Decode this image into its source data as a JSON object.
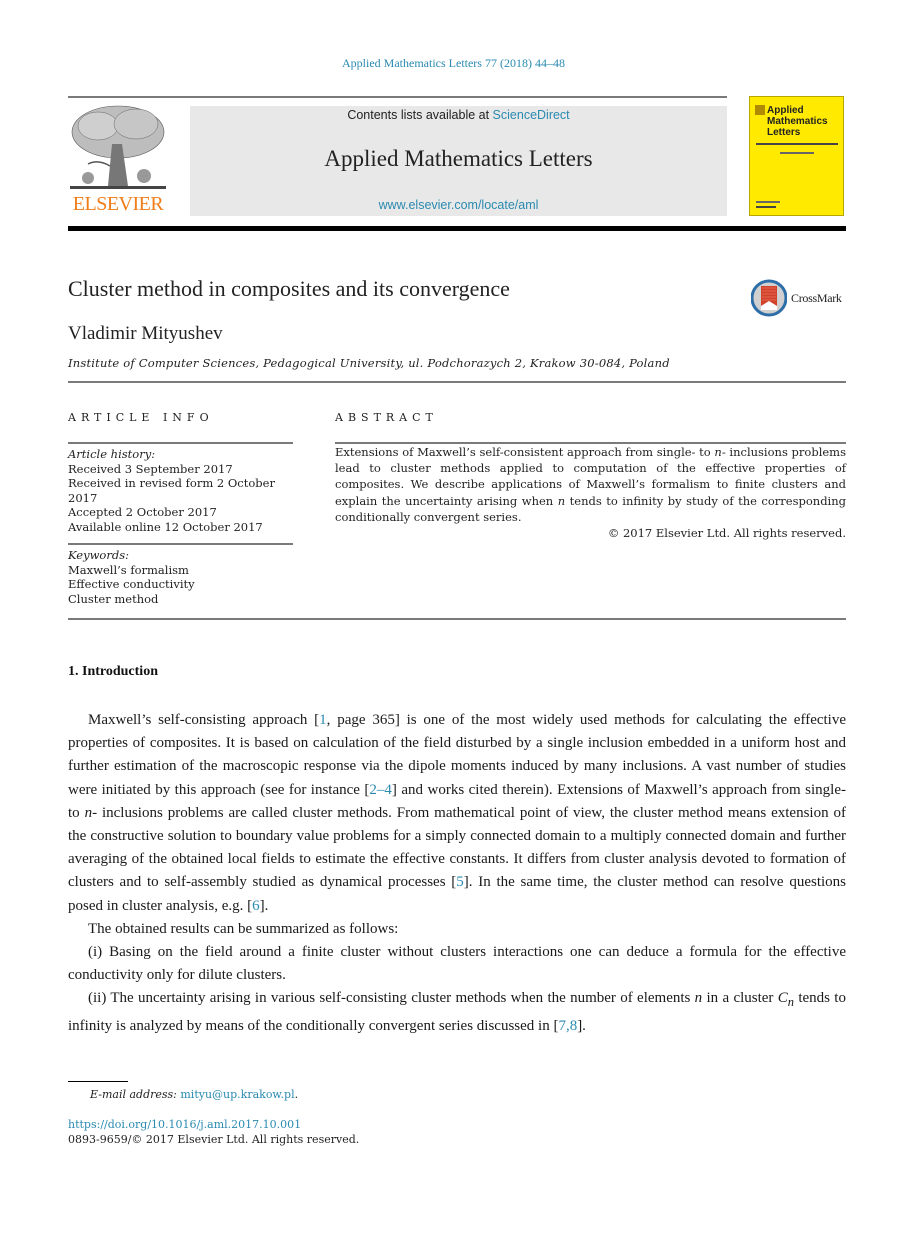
{
  "journal_reference": "Applied Mathematics Letters 77 (2018) 44–48",
  "header": {
    "publisher_logo_text": "ELSEVIER",
    "contents_prefix": "Contents lists available at ",
    "contents_link": "ScienceDirect",
    "journal_title": "Applied Mathematics Letters",
    "journal_url": "www.elsevier.com/locate/aml",
    "cover_title_lines": [
      "Applied",
      "Mathematics",
      "Letters"
    ],
    "cover_color": "#ffea00"
  },
  "article": {
    "title": "Cluster method in composites and its convergence",
    "crossmark_label": "CrossMark",
    "author": "Vladimir Mityushev",
    "affiliation": "Institute of Computer Sciences, Pedagogical University, ul. Podchorazych 2, Krakow 30-084, Poland"
  },
  "article_info": {
    "heading": "ARTICLE INFO",
    "history_label": "Article history:",
    "history": [
      "Received 3 September 2017",
      "Received in revised form 2 October 2017",
      "Accepted 2 October 2017",
      "Available online 12 October 2017"
    ],
    "keywords_label": "Keywords:",
    "keywords": [
      "Maxwell’s formalism",
      "Effective conductivity",
      "Cluster method"
    ]
  },
  "abstract": {
    "heading": "ABSTRACT",
    "text_1": "Extensions of Maxwell’s self-consistent approach from single- to ",
    "var_n": "n",
    "text_2": "- inclusions problems lead to cluster methods applied to computation of the effective properties of composites. We describe applications of Maxwell’s formalism to finite clusters and explain the uncertainty arising when ",
    "text_3": " tends to infinity by study of the corresponding conditionally convergent series.",
    "copyright": "© 2017 Elsevier Ltd. All rights reserved."
  },
  "introduction": {
    "heading": "1. Introduction",
    "p1": {
      "a": "Maxwell’s self-consisting approach [",
      "ref1": "1",
      "b": ", page 365] is one of the most widely used methods for calculating the effective properties of composites. It is based on calculation of the field disturbed by a single inclusion embedded in a uniform host and further estimation of the macroscopic response via the dipole moments induced by many inclusions. A vast number of studies were initiated by this approach (see for instance [",
      "ref2": "2–4",
      "c": "] and works cited therein). Extensions of Maxwell’s approach from single- to ",
      "n": "n",
      "d": "- inclusions problems are called cluster methods. From mathematical point of view, the cluster method means extension of the constructive solution to boundary value problems for a simply connected domain to a multiply connected domain and further averaging of the obtained local fields to estimate the effective constants. It differs from cluster analysis devoted to formation of clusters and to self-assembly studied as dynamical processes [",
      "ref3": "5",
      "e": "]. In the same time, the cluster method can resolve questions posed in cluster analysis, e.g. [",
      "ref4": "6",
      "f": "]."
    },
    "p2": "The obtained results can be summarized as follows:",
    "p3": "(i) Basing on the field around a finite cluster without clusters interactions one can deduce a formula for the effective conductivity only for dilute clusters.",
    "p4": {
      "a": "(ii) The uncertainty arising in various self-consisting cluster methods when the number of elements ",
      "n": "n",
      "b": " in a cluster ",
      "C": "C",
      "sub": "n",
      "c": " tends to infinity is analyzed by means of the conditionally convergent series discussed in [",
      "ref": "7,8",
      "d": "]."
    }
  },
  "footer": {
    "email_label": "E-mail address: ",
    "email": "mityu@up.krakow.pl",
    "email_end": ".",
    "doi": "https://doi.org/10.1016/j.aml.2017.10.001",
    "issn": "0893-9659/© 2017 Elsevier Ltd. All rights reserved."
  }
}
